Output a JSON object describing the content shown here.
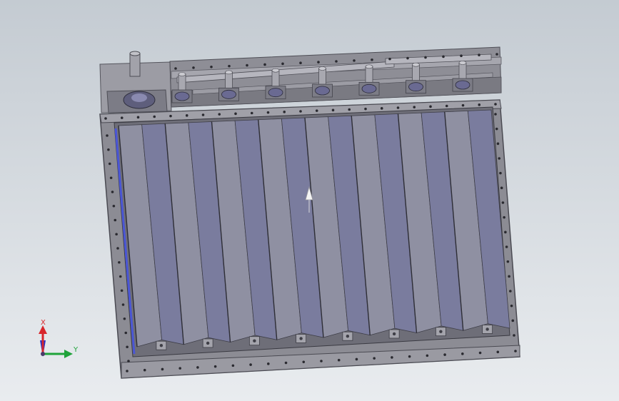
{
  "viewport": {
    "background_top": "#c4cbd2",
    "background_bottom": "#e9ecef"
  },
  "model": {
    "louver_count": 8,
    "frame_color": "#8c8c94",
    "frame_dark": "#56565e",
    "blade_light": "#8f90a2",
    "blade_dark": "#7a7c9e",
    "accent_blue": "#4a56d6"
  },
  "triad": {
    "x_label": "X",
    "y_label": "Y",
    "x_color": "#d8262b",
    "y_color": "#1fa33a",
    "z_color": "#2531c9"
  }
}
